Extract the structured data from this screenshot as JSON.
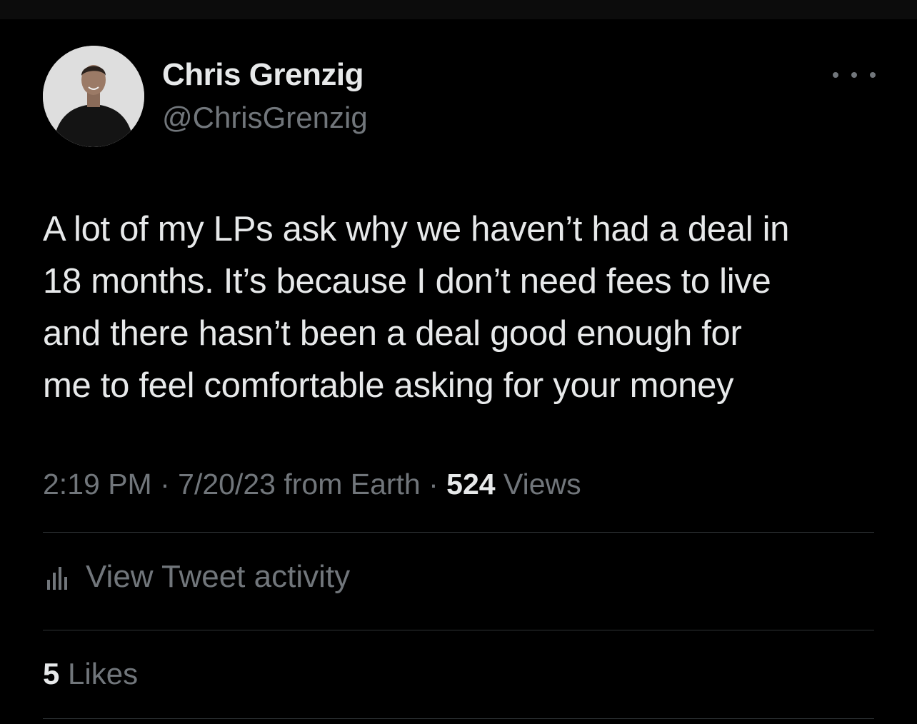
{
  "author": {
    "display_name": "Chris Grenzig",
    "handle": "@ChrisGrenzig",
    "avatar_icon": "profile-photo"
  },
  "more_icon": "ellipsis-icon",
  "tweet": {
    "lines": [
      "A lot of my LPs ask why we haven’t had a deal in",
      "18 months. It’s because I don’t need fees to live",
      "and there hasn’t been a deal good enough for",
      "me to feel comfortable asking for your money"
    ]
  },
  "meta": {
    "time": "2:19 PM",
    "separator": " · ",
    "date": "7/20/23",
    "source": "from Earth",
    "views_count": "524",
    "views_label": "Views"
  },
  "activity": {
    "icon": "bar-chart-icon",
    "label": "View Tweet activity"
  },
  "likes": {
    "count": "5",
    "label": "Likes"
  },
  "colors": {
    "background": "#000000",
    "primary_text": "#e7e9ea",
    "secondary_text": "#71767b",
    "divider": "#2f3336"
  }
}
